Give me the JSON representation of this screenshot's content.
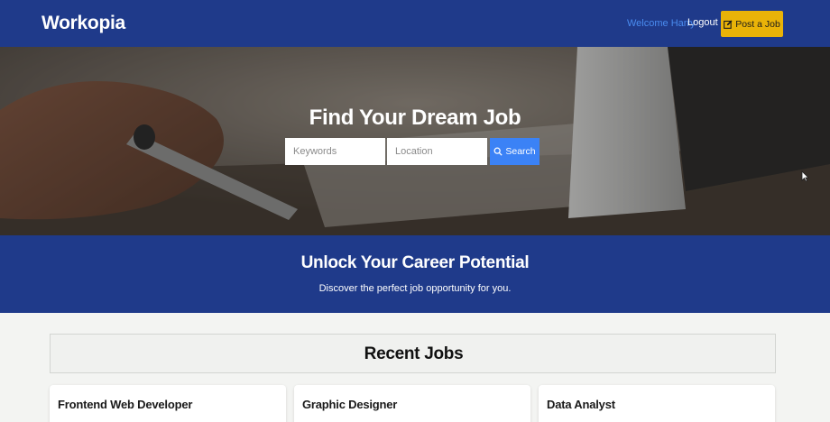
{
  "header": {
    "brand": "Workopia",
    "welcome": "Welcome Harry",
    "logout": "Logout",
    "post_job": "Post a Job",
    "post_job_icon": "edit-icon"
  },
  "hero": {
    "title": "Find Your Dream Job",
    "keywords_placeholder": "Keywords",
    "location_placeholder": "Location",
    "search_label": "Search",
    "search_icon": "search-icon"
  },
  "band": {
    "title": "Unlock Your Career Potential",
    "subtitle": "Discover the perfect job opportunity for you."
  },
  "recent": {
    "title": "Recent Jobs",
    "jobs": [
      {
        "title": "Frontend Web Developer"
      },
      {
        "title": "Graphic Designer"
      },
      {
        "title": "Data Analyst"
      }
    ]
  },
  "colors": {
    "brand_blue": "#1f3a8a",
    "accent_yellow": "#e9b308",
    "search_blue": "#3b82f6",
    "welcome_blue": "#4a8cf0"
  }
}
